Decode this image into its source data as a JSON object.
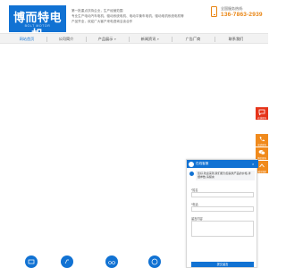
{
  "header": {
    "logo_text": "博而特电机",
    "logo_sub": "BOLT MOTOR",
    "intro_lines": [
      "第一批重点扶持企业，生产经营范围",
      "专业生产电动汽车电机、驱动系统电机、电动平衡车电机、驱动电机系统电机等",
      "产品齐全，欢迎广大客户来电咨询洽谈合作"
    ],
    "hotline_label": "全国服务热线:",
    "hotline_number": "136-7863-2939"
  },
  "nav": {
    "items": [
      {
        "label": "网站首页",
        "active": true
      },
      {
        "label": "公司简介",
        "active": false
      },
      {
        "label": "产品展示",
        "active": false
      },
      {
        "label": "新闻资讯",
        "active": false
      },
      {
        "label": "广告厂商",
        "active": false
      },
      {
        "label": "联系我们",
        "active": false
      }
    ]
  },
  "side": {
    "online_label": "在线咨询",
    "phone_label": "电话咨询",
    "wechat_label": "微信咨询",
    "top_label": "返回顶部"
  },
  "chat": {
    "title": "在线客服",
    "close": "×",
    "message": "您好,欢迎来到,我们能为您提供产品的价格,详细参数,请留言",
    "name_label": "*姓名",
    "phone_label": "*电话",
    "message_label": "留言内容",
    "submit_label": "提交留言"
  },
  "colors": {
    "brand_blue": "#1172d3",
    "accent_orange": "#e8820e",
    "side_red": "#e6341a"
  },
  "products": [
    "motor-icon",
    "scooter-icon",
    "bike-icon",
    "wheel-icon"
  ]
}
